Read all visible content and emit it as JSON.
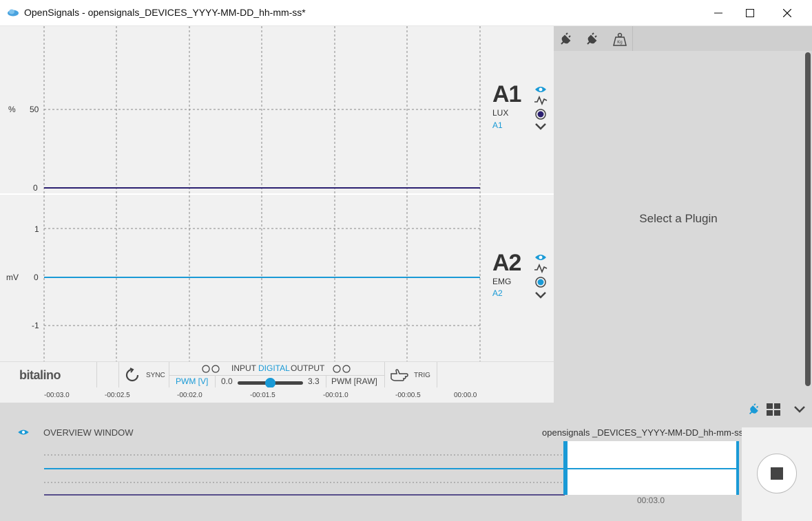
{
  "window": {
    "title": "OpenSignals - opensignals_DEVICES_YYYY-MM-DD_hh-mm-ss*"
  },
  "channels": [
    {
      "name": "A1",
      "type": "LUX",
      "id": "A1",
      "unit": "%",
      "ticks": [
        "50",
        "0"
      ],
      "color": "#2b2070"
    },
    {
      "name": "A2",
      "type": "EMG",
      "id": "A2",
      "unit": "mV",
      "ticks": [
        "1",
        "0",
        "-1"
      ],
      "color": "#1a9ad6"
    }
  ],
  "device_bar": {
    "logo": "bitalino",
    "sync_label": "SYNC",
    "io_input": "INPUT",
    "io_digital": "DIGITAL",
    "io_output": "OUTPUT",
    "pwm_v_label": "PWM [V]",
    "pwm_min": "0.0",
    "pwm_max": "3.3",
    "pwm_raw_label": "PWM [RAW]",
    "trig_label": "TRIG"
  },
  "plugin_panel": {
    "message": "Select a Plugin"
  },
  "time_axis": {
    "ticks": [
      "-00:03.0",
      "-00:02.5",
      "-00:02.0",
      "-00:01.5",
      "-00:01.0",
      "-00:00.5",
      "00:00.0"
    ]
  },
  "overview": {
    "title": "OVERVIEW WINDOW",
    "file_name": "opensignals _DEVICES_YYYY-MM-DD_hh-mm-ss*",
    "time_label": "00:03.0"
  },
  "colors": {
    "accent": "#1a9ad6",
    "dark_series": "#2b2070"
  }
}
